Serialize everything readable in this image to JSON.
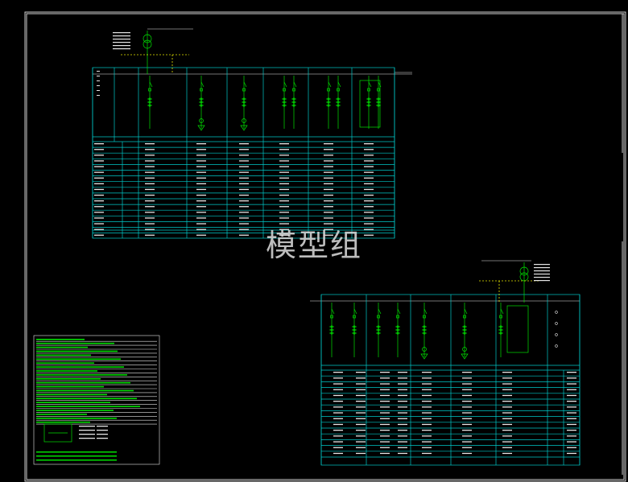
{
  "watermark": "模型组",
  "colors": {
    "background": "#000000",
    "frame": "#d0d0d0",
    "grid": "#00c8c8",
    "symbols": "#00e000",
    "text": "#e6e6e6",
    "bus": "#e6e600"
  },
  "panel_top": {
    "columns": 6,
    "table_rows": 17
  },
  "panel_bottom": {
    "columns": 6,
    "table_rows": 15
  },
  "notes": {
    "lines": 22
  }
}
